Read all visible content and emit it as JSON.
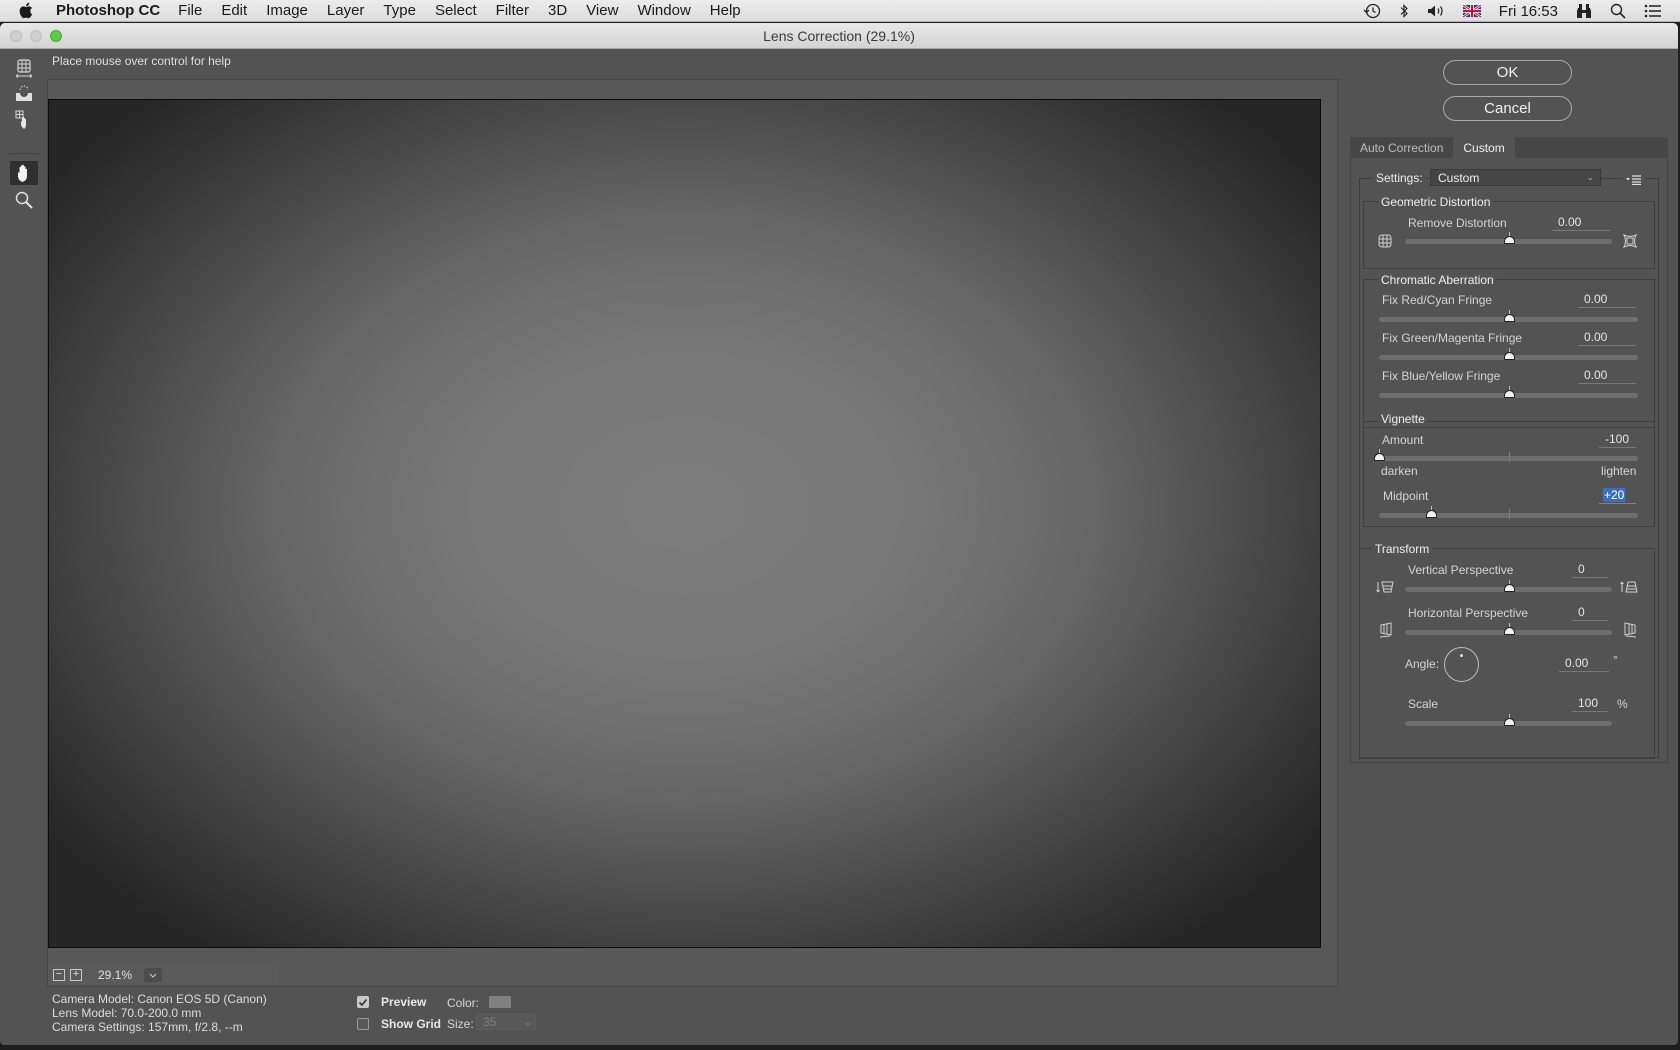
{
  "menubar": {
    "app_name": "Photoshop CC",
    "items": [
      "File",
      "Edit",
      "Image",
      "Layer",
      "Type",
      "Select",
      "Filter",
      "3D",
      "View",
      "Window",
      "Help"
    ],
    "clock": "Fri 16:53",
    "status_icons": [
      "time-machine-icon",
      "bluetooth-icon",
      "volume-icon",
      "uk-flag-input-icon",
      "binoculars-icon",
      "spotlight-search-icon",
      "notification-center-icon"
    ]
  },
  "window": {
    "title": "Lens Correction (29.1%)",
    "help_text": "Place mouse over control for help"
  },
  "tools": [
    {
      "name": "remove-distortion-tool-icon",
      "active": false
    },
    {
      "name": "straighten-tool-icon",
      "active": false
    },
    {
      "name": "move-grid-tool-icon",
      "active": false
    },
    {
      "name": "hand-tool-icon",
      "active": true
    },
    {
      "name": "zoom-tool-icon",
      "active": false
    }
  ],
  "preview": {
    "zoom_value": "29.1%",
    "zoom_out_label": "−",
    "zoom_in_label": "+",
    "camera_model": "Camera Model: Canon EOS 5D (Canon)",
    "lens_model": "Lens Model: 70.0-200.0 mm",
    "camera_settings": "Camera Settings: 157mm, f/2.8, --m",
    "preview_label": "Preview",
    "preview_checked": true,
    "show_grid_label": "Show Grid",
    "show_grid_checked": false,
    "color_label": "Color:",
    "grid_color": "#808080",
    "size_label": "Size:",
    "size_value": "35"
  },
  "buttons": {
    "ok": "OK",
    "cancel": "Cancel"
  },
  "tabs": [
    {
      "label": "Auto Correction",
      "active": false
    },
    {
      "label": "Custom",
      "active": true
    }
  ],
  "settings": {
    "label": "Settings:",
    "value": "Custom"
  },
  "geometric": {
    "legend": "Geometric Distortion",
    "remove_distortion": {
      "label": "Remove Distortion",
      "value": "0.00",
      "fraction": 0.5
    }
  },
  "chromatic": {
    "legend": "Chromatic Aberration",
    "red_cyan": {
      "label": "Fix Red/Cyan Fringe",
      "value": "0.00",
      "fraction": 0.5
    },
    "green_magenta": {
      "label": "Fix Green/Magenta Fringe",
      "value": "0.00",
      "fraction": 0.5
    },
    "blue_yellow": {
      "label": "Fix Blue/Yellow Fringe",
      "value": "0.00",
      "fraction": 0.5
    }
  },
  "vignette": {
    "legend": "Vignette",
    "amount": {
      "label": "Amount",
      "value": "-100",
      "fraction": 0.0
    },
    "darken_label": "darken",
    "lighten_label": "lighten",
    "midpoint": {
      "label": "Midpoint",
      "value": "+20",
      "fraction": 0.2
    }
  },
  "transform": {
    "legend": "Transform",
    "vertical": {
      "label": "Vertical Perspective",
      "value": "0",
      "fraction": 0.5
    },
    "horizontal": {
      "label": "Horizontal Perspective",
      "value": "0",
      "fraction": 0.5
    },
    "angle": {
      "label": "Angle:",
      "value": "0.00",
      "unit": "°"
    },
    "scale": {
      "label": "Scale",
      "value": "100",
      "unit": "%",
      "fraction": 0.5
    }
  }
}
